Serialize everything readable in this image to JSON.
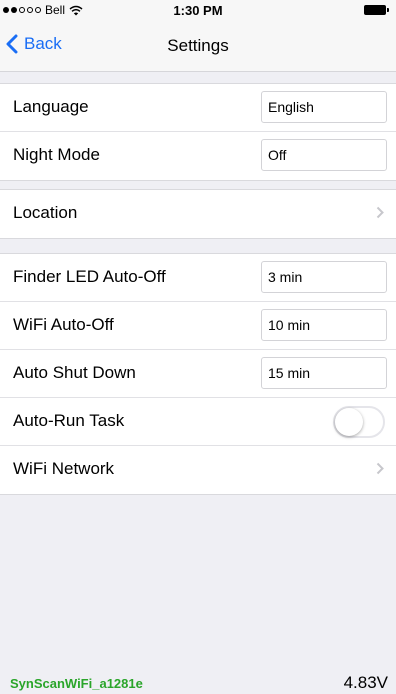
{
  "status_bar": {
    "carrier": "Bell",
    "time": "1:30 PM",
    "signal_bars": 2,
    "signal_total": 5
  },
  "nav": {
    "back_label": "Back",
    "title": "Settings"
  },
  "settings": {
    "language": {
      "label": "Language",
      "value": "English"
    },
    "night_mode": {
      "label": "Night Mode",
      "value": "Off"
    },
    "location": {
      "label": "Location"
    },
    "finder_led": {
      "label": "Finder LED Auto-Off",
      "value": "3 min"
    },
    "wifi_auto_off": {
      "label": "WiFi Auto-Off",
      "value": "10 min"
    },
    "auto_shut_down": {
      "label": "Auto Shut Down",
      "value": "15 min"
    },
    "auto_run_task": {
      "label": "Auto-Run Task",
      "enabled": false
    },
    "wifi_network": {
      "label": "WiFi Network"
    }
  },
  "footer": {
    "ssid": "SynScanWiFi_a1281e",
    "voltage": "4.83V"
  },
  "colors": {
    "accent": "#1a6ef5",
    "ssid": "#2aa52a",
    "background": "#efeff4"
  }
}
